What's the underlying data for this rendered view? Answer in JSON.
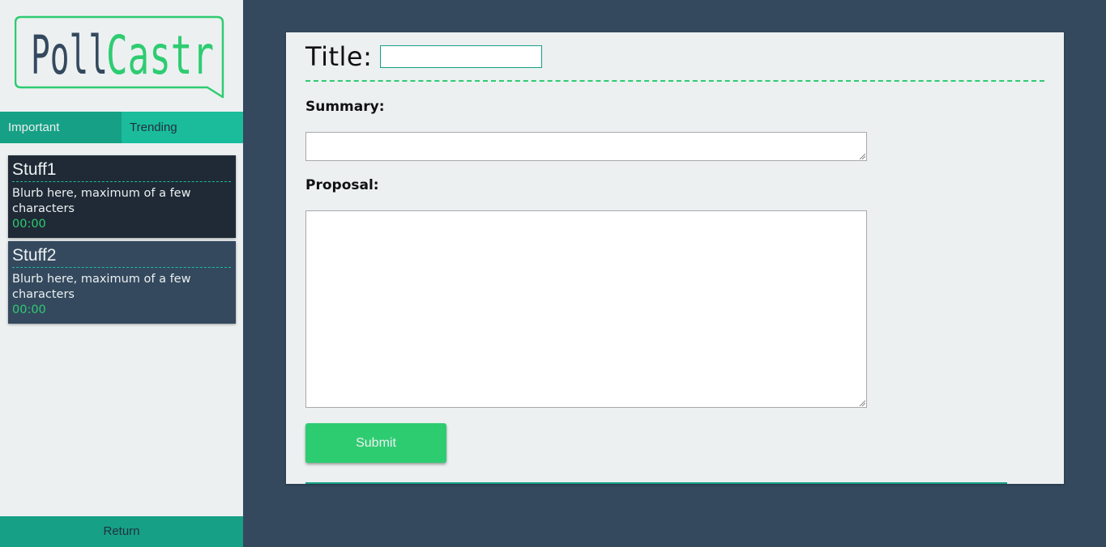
{
  "brand": {
    "logo_part1": "Poll",
    "logo_part2": "Castr",
    "colors": {
      "dark": "#34495e",
      "accent": "#2ecc71"
    }
  },
  "sidebar": {
    "tabs": [
      {
        "label": "Important",
        "active": true
      },
      {
        "label": "Trending",
        "active": false
      }
    ],
    "cards": [
      {
        "title": "Stuff1",
        "blurb": "Blurb here, maximum of a few characters",
        "time": "00:00"
      },
      {
        "title": "Stuff2",
        "blurb": "Blurb here, maximum of a few characters",
        "time": "00:00"
      }
    ],
    "return_label": "Return"
  },
  "form": {
    "title_label": "Title:",
    "title_value": "",
    "summary_label": "Summary:",
    "summary_value": "",
    "proposal_label": "Proposal:",
    "proposal_value": "",
    "submit_label": "Submit"
  },
  "colors": {
    "background": "#34495e",
    "panel": "#ecf0f1",
    "teal": "#16a085",
    "turquoise": "#1abc9c",
    "green": "#2ecc71",
    "card_dark": "#1f2a36"
  }
}
